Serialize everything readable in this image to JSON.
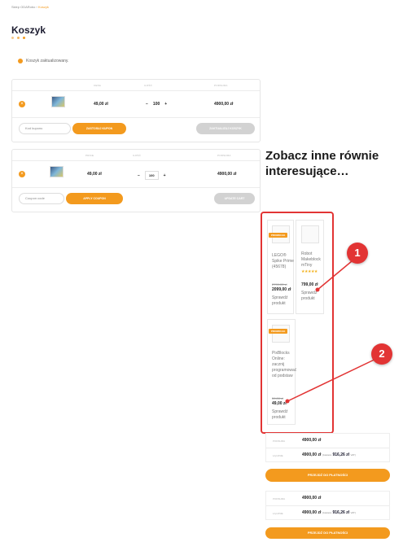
{
  "breadcrumb": {
    "home": "Sklep ODARobo",
    "sep": "›",
    "current": "Koszyk"
  },
  "page_title": "Koszyk",
  "colors": {
    "accent": "#f39a1e",
    "annotation": "#e23434"
  },
  "notice": "Koszyk zaktualizowany.",
  "cart1": {
    "headers": {
      "price": "CENA",
      "qty": "ILOŚĆ",
      "subtotal": "PODSUMA"
    },
    "item": {
      "remove": "×",
      "price": "49,00 zł",
      "qty_minus": "−",
      "qty": "100",
      "qty_plus": "+",
      "subtotal": "4900,00 zł"
    },
    "coupon_placeholder": "Kod kuponu",
    "apply_label": "ZASTOSUJ KUPON",
    "update_label": "ZAKTUALIZUJ KOSZYK"
  },
  "cart2": {
    "headers": {
      "price": "PRICE",
      "qty": "ILOŚĆ",
      "subtotal": "PODSUMA"
    },
    "item": {
      "remove": "×",
      "price": "49,00 zł",
      "qty_minus": "−",
      "qty": "100",
      "qty_plus": "+",
      "subtotal": "4900,00 zł"
    },
    "coupon_placeholder": "Coupon code",
    "apply_label": "APPLY COUPON",
    "update_label": "UPDATE CART"
  },
  "related": {
    "heading": "Zobacz inne równie interesujące…",
    "products": [
      {
        "promo": "PROMOCJA",
        "name": "LEGO® Spike Prime (45678)",
        "old_price": "2799,00 zł",
        "price": "2099,00 zł",
        "link": "Sprawdź produkt"
      },
      {
        "promo": "",
        "name": "Robot Makeblock mTiny",
        "old_price": "",
        "price": "799,00 zł",
        "link": "Sprawdź produkt",
        "rating": 5
      },
      {
        "promo": "PROMOCJA",
        "name": "PixBlocks Online: zacznij programować od podstaw",
        "old_price": "59,00 zł",
        "price": "49,00 zł",
        "link": "Sprawdź produkt"
      }
    ]
  },
  "callouts": [
    "1",
    "2"
  ],
  "totals1": {
    "subtotal_label": "PODSUMA",
    "subtotal": "4900,00 zł",
    "total_label": "ŁĄCZNIE",
    "total": "4900,00 zł",
    "vat_prefix": "(zawiera",
    "vat": "916,26 zł",
    "vat_suffix": "VAT)",
    "checkout": "PRZEJDŹ DO PŁATNOŚCI"
  },
  "totals2": {
    "subtotal_label": "PODSUMA",
    "subtotal": "4900,00 zł",
    "total_label": "ŁĄCZNIE",
    "total": "4900,00 zł",
    "vat_prefix": "(zawiera",
    "vat": "916,26 zł",
    "vat_suffix": "VAT)",
    "checkout": "PRZEJDŹ DO PŁATNOŚCI"
  }
}
